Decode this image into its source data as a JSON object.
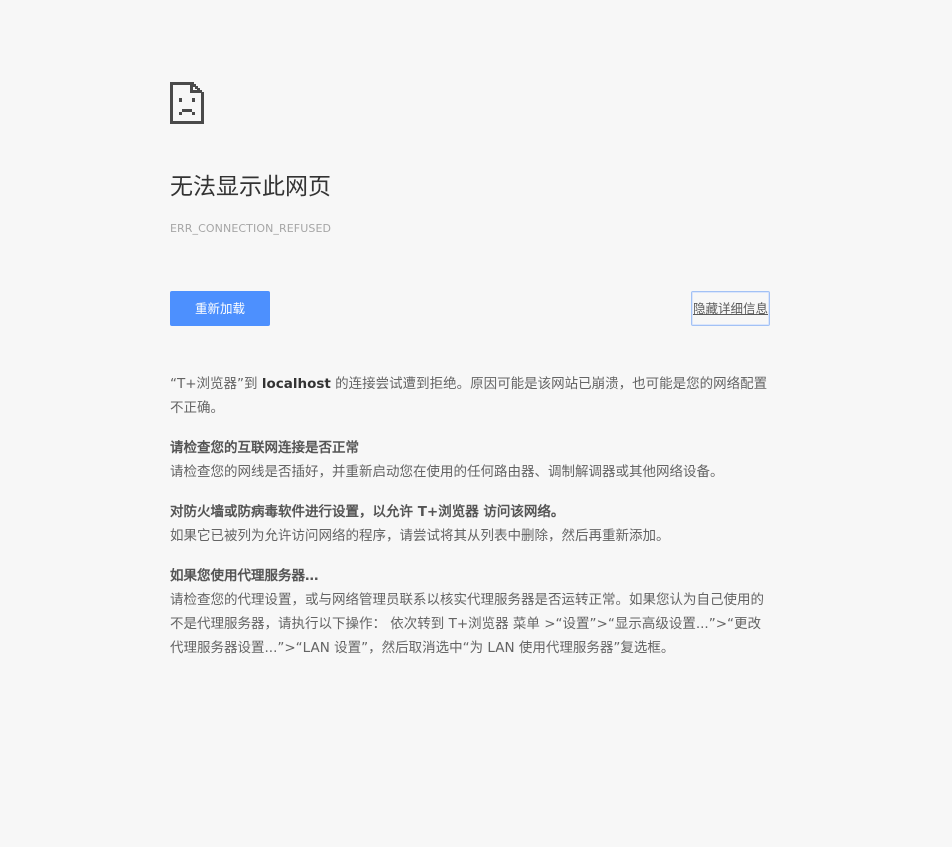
{
  "error_page": {
    "title": "无法显示此网页",
    "error_code": "ERR_CONNECTION_REFUSED",
    "reload_label": "重新加载",
    "details_label": "隐藏详细信息",
    "intro": {
      "prefix": "“T+浏览器”到 ",
      "host": "localhost",
      "suffix": " 的连接尝试遭到拒绝。原因可能是该网站已崩溃，也可能是您的网络配置不正确。"
    },
    "sections": [
      {
        "title": "请检查您的互联网连接是否正常",
        "body": "请检查您的网线是否插好，并重新启动您在使用的任何路由器、调制解调器或其他网络设备。"
      },
      {
        "title": "对防火墙或防病毒软件进行设置，以允许 T+浏览器 访问该网络。",
        "body": "如果它已被列为允许访问网络的程序，请尝试将其从列表中删除，然后再重新添加。"
      },
      {
        "title": "如果您使用代理服务器…",
        "body": "请检查您的代理设置，或与网络管理员联系以核实代理服务器是否运转正常。如果您认为自己使用的不是代理服务器，请执行以下操作： 依次转到 T+浏览器 菜单 >“设置”>“显示高级设置...”>“更改代理服务器设置...”>“LAN 设置”，然后取消选中“为 LAN 使用代理服务器”复选框。"
      }
    ],
    "colors": {
      "background": "#f7f7f7",
      "accent": "#4d90fe",
      "title_text": "#333333",
      "body_text": "#646464"
    },
    "icon": "sad-page-icon"
  }
}
